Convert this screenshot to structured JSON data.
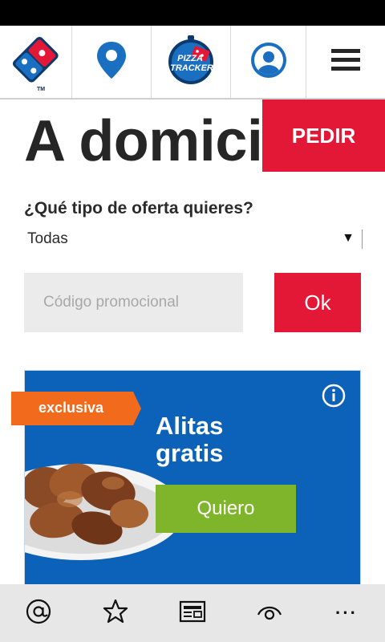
{
  "nav": {
    "tracker_text_line1": "PIZZA",
    "tracker_text_line2": "TRACKER",
    "logo_tm": "TM"
  },
  "page": {
    "title": "A domicilio",
    "order_label": "PEDIR",
    "offer_question": "¿Qué tipo de oferta quieres?",
    "offer_selected": "Todas",
    "promo_placeholder": "Código promocional",
    "ok_label": "Ok"
  },
  "promo": {
    "tag": "exclusiva",
    "title_line1": "Alitas",
    "title_line2": "gratis",
    "button_label": "Quiero"
  },
  "colors": {
    "brand_red": "#e31837",
    "brand_blue": "#0c62b8",
    "accent_green": "#7fb52a",
    "tag_orange": "#f26a1b"
  },
  "bottom_bar": {
    "icons": [
      "at-icon",
      "star-icon",
      "reading-view-icon",
      "eye-icon",
      "more-icon"
    ],
    "more_label": "···"
  }
}
